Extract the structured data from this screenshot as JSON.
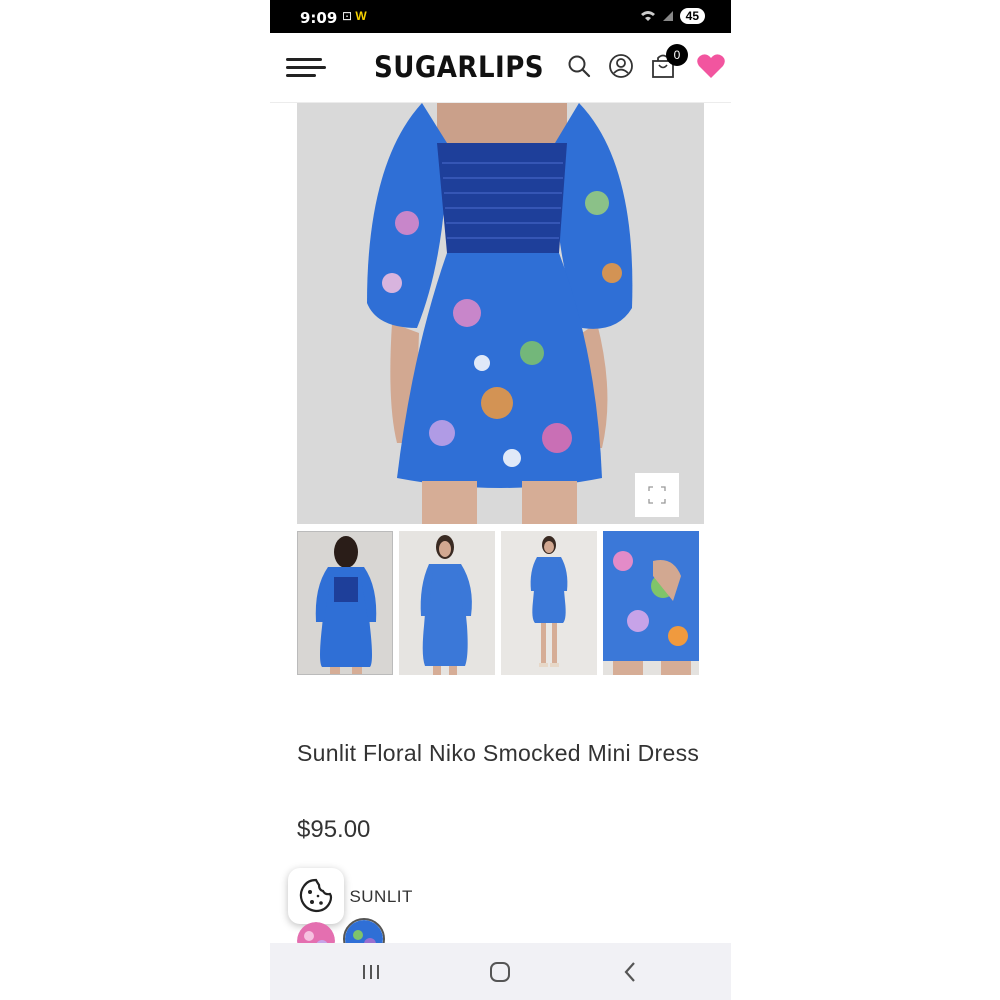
{
  "status_bar": {
    "time": "9:09",
    "left_icons": [
      "screenshot-icon",
      "w-app-icon"
    ],
    "battery": "45"
  },
  "header": {
    "brand": "SUGARLIPS",
    "cart_count": "0",
    "icons": [
      "menu-icon",
      "search-icon",
      "account-icon",
      "cart-icon",
      "heart-icon"
    ],
    "heart_color": "#f2559f"
  },
  "product": {
    "title": "Sunlit Floral Niko Smocked Mini Dress",
    "price": "$95.00",
    "variant_label": "T: SUNLIT",
    "thumbnail_count": 4,
    "swatches": [
      "pink-floral",
      "blue-floral"
    ]
  },
  "colors": {
    "dress_blue": "#2f6fd6",
    "dress_dark_blue": "#1e3f9a",
    "background_gray": "#dcdcdc"
  },
  "nav_bar": {
    "icons": [
      "recent-apps-icon",
      "home-icon",
      "back-icon"
    ]
  }
}
